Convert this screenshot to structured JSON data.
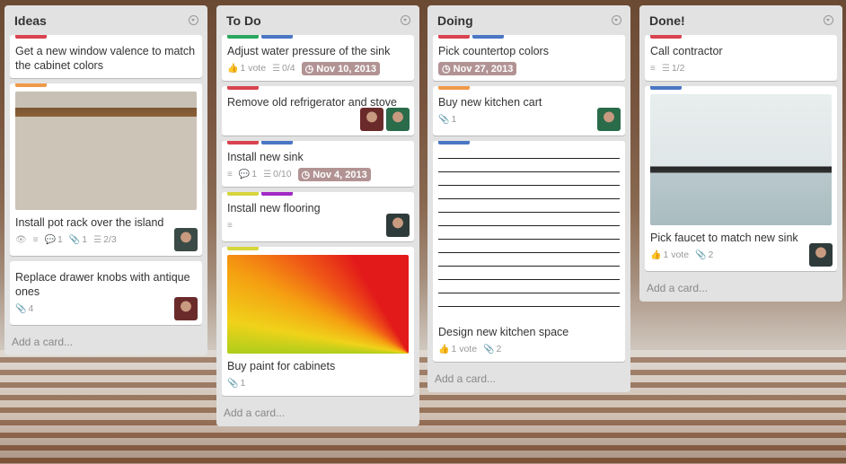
{
  "colors": {
    "red": "#d9434f",
    "blue": "#4a76c4",
    "green": "#2aa65e",
    "orange": "#ef9a4a",
    "yellow": "#d6d63d",
    "purple": "#a22bc4",
    "due": "#b29393"
  },
  "add_card_label": "Add a card...",
  "lists": [
    {
      "title": "Ideas",
      "cards": [
        {
          "labels": [
            "red"
          ],
          "title": "Get a new window valence to match the cabinet colors"
        },
        {
          "labels": [
            "orange"
          ],
          "cover": "pot-rack-photo",
          "title": "Install pot rack over the island",
          "badges": {
            "watch": true,
            "description": true,
            "comments": "1",
            "attachments": "1",
            "checklist": "2/3"
          },
          "members": 1
        },
        {
          "labels": [],
          "title": "Replace drawer knobs with antique ones",
          "badges": {
            "attachments": "4"
          },
          "members": 1
        }
      ]
    },
    {
      "title": "To Do",
      "cards": [
        {
          "labels": [
            "green",
            "blue"
          ],
          "title": "Adjust water pressure of the sink",
          "badges": {
            "votes": "1 vote",
            "checklist": "0/4",
            "due": "Nov 10, 2013"
          }
        },
        {
          "labels": [
            "red"
          ],
          "title": "Remove old refrigerator and stove",
          "members": 2
        },
        {
          "labels": [
            "red",
            "blue"
          ],
          "title": "Install new sink",
          "badges": {
            "description": true,
            "comments": "1",
            "checklist": "0/10",
            "due": "Nov 4, 2013"
          }
        },
        {
          "labels": [
            "yellow",
            "purple"
          ],
          "title": "Install new flooring",
          "badges": {
            "description": true
          },
          "members": 1
        },
        {
          "labels": [
            "yellow"
          ],
          "cover": "paint-swatch-photo",
          "title": "Buy paint for cabinets",
          "badges": {
            "attachments": "1"
          }
        }
      ]
    },
    {
      "title": "Doing",
      "cards": [
        {
          "labels": [
            "red",
            "blue"
          ],
          "title": "Pick countertop colors",
          "badges": {
            "due": "Nov 27, 2013"
          }
        },
        {
          "labels": [
            "orange"
          ],
          "title": "Buy new kitchen cart",
          "badges": {
            "attachments": "1"
          },
          "members": 1
        },
        {
          "labels": [
            "blue"
          ],
          "cover": "floor-plan-drawing",
          "title": "Design new kitchen space",
          "badges": {
            "votes": "1 vote",
            "attachments": "2"
          }
        }
      ]
    },
    {
      "title": "Done!",
      "cards": [
        {
          "labels": [
            "red"
          ],
          "title": "Call contractor",
          "badges": {
            "description": true,
            "checklist": "1/2"
          }
        },
        {
          "labels": [
            "blue"
          ],
          "cover": "faucet-photo",
          "title": "Pick faucet to match new sink",
          "badges": {
            "votes": "1 vote",
            "attachments": "2"
          },
          "members": 1
        }
      ]
    }
  ]
}
